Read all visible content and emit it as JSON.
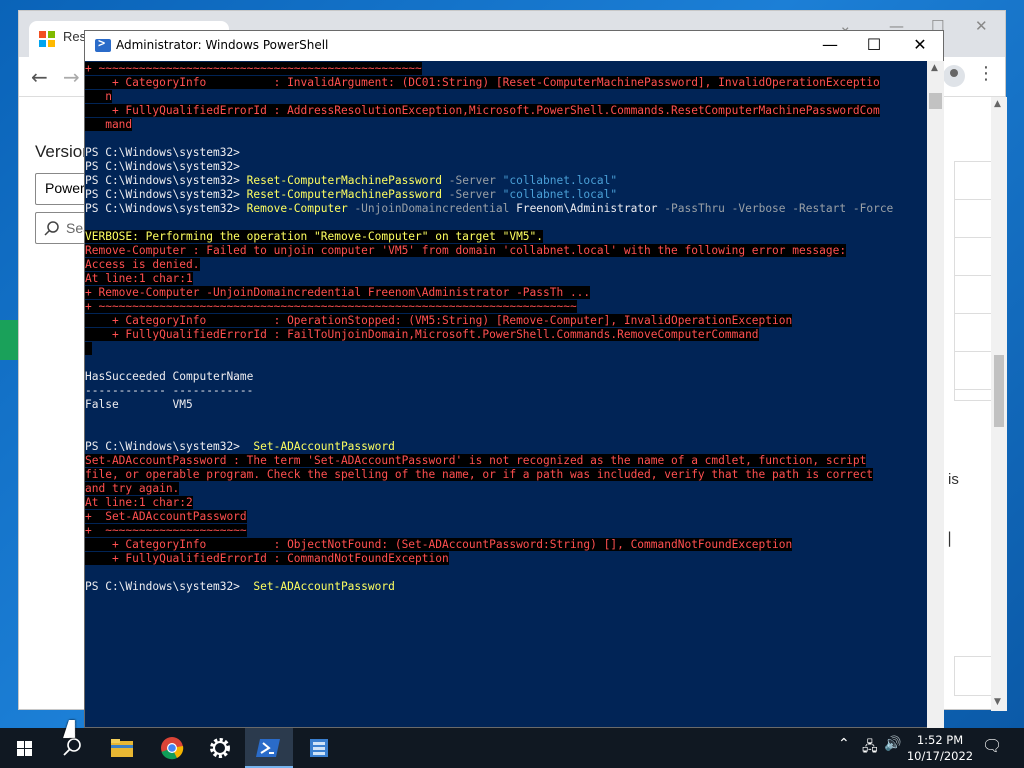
{
  "browser": {
    "tab_title": "Rese",
    "version_label": "Version",
    "version_select": "Power",
    "search_placeholder": "Sea",
    "right_text": "is",
    "right_bar": "|"
  },
  "powershell": {
    "title": "Administrator: Windows PowerShell",
    "controls": {
      "minimize": "—",
      "maximize": "☐",
      "close": "✕"
    },
    "lines": [
      [
        {
          "t": "+ ~~~~~~~~~~~~~~~~~~~~~~~~~~~~~~~~~~~~~~~~~~~~~~~~",
          "c": "err"
        }
      ],
      [
        {
          "t": "    + CategoryInfo          : InvalidArgument: (DC01:String) [Reset-ComputerMachinePassword], InvalidOperationExceptio",
          "c": "err"
        }
      ],
      [
        {
          "t": "   n",
          "c": "err"
        }
      ],
      [
        {
          "t": "    + FullyQualifiedErrorId : AddressResolutionException,Microsoft.PowerShell.Commands.ResetComputerMachinePasswordCom",
          "c": "err"
        }
      ],
      [
        {
          "t": "   mand",
          "c": "err"
        }
      ],
      [
        {
          "t": "",
          "c": "plain"
        }
      ],
      [
        {
          "t": "PS C:\\Windows\\system32>",
          "c": "plain"
        }
      ],
      [
        {
          "t": "PS C:\\Windows\\system32>",
          "c": "plain"
        }
      ],
      [
        {
          "t": "PS C:\\Windows\\system32> ",
          "c": "plain"
        },
        {
          "t": "Reset-ComputerMachinePassword",
          "c": "cmd"
        },
        {
          "t": " -Server ",
          "c": "param"
        },
        {
          "t": "\"collabnet.local\"",
          "c": "str"
        }
      ],
      [
        {
          "t": "PS C:\\Windows\\system32> ",
          "c": "plain"
        },
        {
          "t": "Reset-ComputerMachinePassword",
          "c": "cmd"
        },
        {
          "t": " -Server ",
          "c": "param"
        },
        {
          "t": "\"collabnet.local\"",
          "c": "str"
        }
      ],
      [
        {
          "t": "PS C:\\Windows\\system32> ",
          "c": "plain"
        },
        {
          "t": "Remove-Computer",
          "c": "cmd"
        },
        {
          "t": " -UnjoinDomaincredential ",
          "c": "param"
        },
        {
          "t": "Freenom\\Administrator",
          "c": "plain"
        },
        {
          "t": " -PassThru -Verbose -Restart -Force",
          "c": "param"
        }
      ],
      [
        {
          "t": "",
          "c": "plain"
        }
      ],
      [
        {
          "t": "VERBOSE: Performing the operation \"Remove-Computer\" on target \"VM5\".",
          "c": "verb"
        }
      ],
      [
        {
          "t": "Remove-Computer : Failed to unjoin computer 'VM5' from domain 'collabnet.local' with the following error message:",
          "c": "err"
        }
      ],
      [
        {
          "t": "Access is denied.",
          "c": "err"
        }
      ],
      [
        {
          "t": "At line:1 char:1",
          "c": "err"
        }
      ],
      [
        {
          "t": "+ Remove-Computer -UnjoinDomaincredential Freenom\\Administrator -PassTh ...",
          "c": "err"
        }
      ],
      [
        {
          "t": "+ ~~~~~~~~~~~~~~~~~~~~~~~~~~~~~~~~~~~~~~~~~~~~~~~~~~~~~~~~~~~~~~~~~~~~~~~",
          "c": "err"
        }
      ],
      [
        {
          "t": "    + CategoryInfo          : OperationStopped: (VM5:String) [Remove-Computer], InvalidOperationException",
          "c": "err"
        }
      ],
      [
        {
          "t": "    + FullyQualifiedErrorId : FailToUnjoinDomain,Microsoft.PowerShell.Commands.RemoveComputerCommand",
          "c": "err"
        }
      ],
      [
        {
          "t": " ",
          "c": "err"
        }
      ],
      [
        {
          "t": "",
          "c": "plain"
        }
      ],
      [
        {
          "t": "HasSucceeded ComputerName",
          "c": "plain"
        }
      ],
      [
        {
          "t": "------------ ------------",
          "c": "plain"
        }
      ],
      [
        {
          "t": "False        VM5",
          "c": "plain"
        }
      ],
      [
        {
          "t": "",
          "c": "plain"
        }
      ],
      [
        {
          "t": "",
          "c": "plain"
        }
      ],
      [
        {
          "t": "PS C:\\Windows\\system32>  ",
          "c": "plain"
        },
        {
          "t": "Set-ADAccountPassword",
          "c": "cmd"
        }
      ],
      [
        {
          "t": "Set-ADAccountPassword : The term 'Set-ADAccountPassword' is not recognized as the name of a cmdlet, function, script",
          "c": "err"
        }
      ],
      [
        {
          "t": "file, or operable program. Check the spelling of the name, or if a path was included, verify that the path is correct",
          "c": "err"
        }
      ],
      [
        {
          "t": "and try again.",
          "c": "err"
        }
      ],
      [
        {
          "t": "At line:1 char:2",
          "c": "err"
        }
      ],
      [
        {
          "t": "+  Set-ADAccountPassword",
          "c": "err"
        }
      ],
      [
        {
          "t": "+  ~~~~~~~~~~~~~~~~~~~~~",
          "c": "err"
        }
      ],
      [
        {
          "t": "    + CategoryInfo          : ObjectNotFound: (Set-ADAccountPassword:String) [], CommandNotFoundException",
          "c": "err"
        }
      ],
      [
        {
          "t": "    + FullyQualifiedErrorId : CommandNotFoundException",
          "c": "err"
        }
      ],
      [
        {
          "t": "",
          "c": "plain"
        }
      ],
      [
        {
          "t": "PS C:\\Windows\\system32>  ",
          "c": "plain"
        },
        {
          "t": "Set-ADAccountPassword",
          "c": "cmd"
        }
      ]
    ]
  },
  "taskbar": {
    "time": "1:52 PM",
    "date": "10/17/2022",
    "items": [
      {
        "name": "file-explorer-icon"
      },
      {
        "name": "chrome-icon"
      },
      {
        "name": "settings-icon"
      },
      {
        "name": "powershell-icon"
      },
      {
        "name": "server-manager-icon"
      }
    ]
  },
  "colors": {
    "ps_background": "#012456",
    "error_text": "#ff5050",
    "verbose_text": "#ffff60",
    "taskbar": "#101822"
  }
}
